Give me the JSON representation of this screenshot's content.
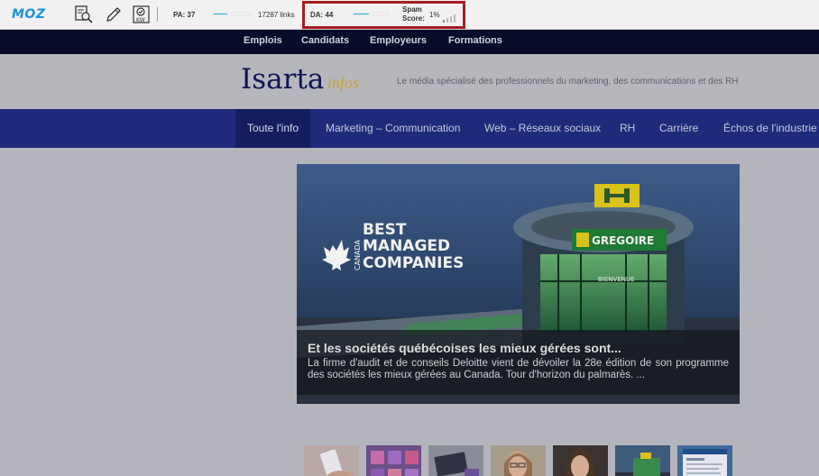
{
  "mozbar": {
    "logo": "MOZ",
    "icons": [
      "page-analysis-icon",
      "highlighter-pen-icon",
      "keyword-check-icon"
    ],
    "pa_label": "PA: 37",
    "pa_fill_fraction": 0.37,
    "links_label": "17287 links",
    "da_label": "DA: 44",
    "da_fill_fraction": 0.44,
    "spam_label_line1": "Spam",
    "spam_label_line2": "Score:",
    "spam_value": "1%",
    "highlight_color": "#a51e22",
    "accent_color": "#2bbbe4"
  },
  "topnav": {
    "items": [
      "Emplois",
      "Candidats",
      "Employeurs",
      "Formations"
    ]
  },
  "header": {
    "brand": "Isarta",
    "brand_sub": "infos",
    "tagline": "Le média spécialisé des professionnels du marketing, des communications et des RH"
  },
  "mainnav": {
    "items": [
      "Toute l'info",
      "Marketing – Communication",
      "Web – Réseaux sociaux",
      "RH",
      "Carrière",
      "Échos de l'industrie"
    ],
    "active_index": 0
  },
  "hero": {
    "sign_line1": "CANADA",
    "sign_line2": "BEST",
    "sign_line3": "MANAGED",
    "sign_line4": "COMPANIES",
    "store_name": "GREGOIRE",
    "store_welcome": "BIENVENUE",
    "caption_title": "Et les sociétés québécoises les mieux gérées sont...",
    "caption_text": "La firme d'audit et de conseils Deloitte vient de dévoiler la 28e édition de son programme des sociétés les mieux gérées au Canada. Tour d'horizon du palmarès. ..."
  },
  "thumbnails": [
    {
      "name": "thumb-phone-hand"
    },
    {
      "name": "thumb-purple-cards"
    },
    {
      "name": "thumb-laptop-desk"
    },
    {
      "name": "thumb-woman-glasses"
    },
    {
      "name": "thumb-woman-portrait"
    },
    {
      "name": "thumb-store-building"
    },
    {
      "name": "thumb-web-page"
    }
  ]
}
